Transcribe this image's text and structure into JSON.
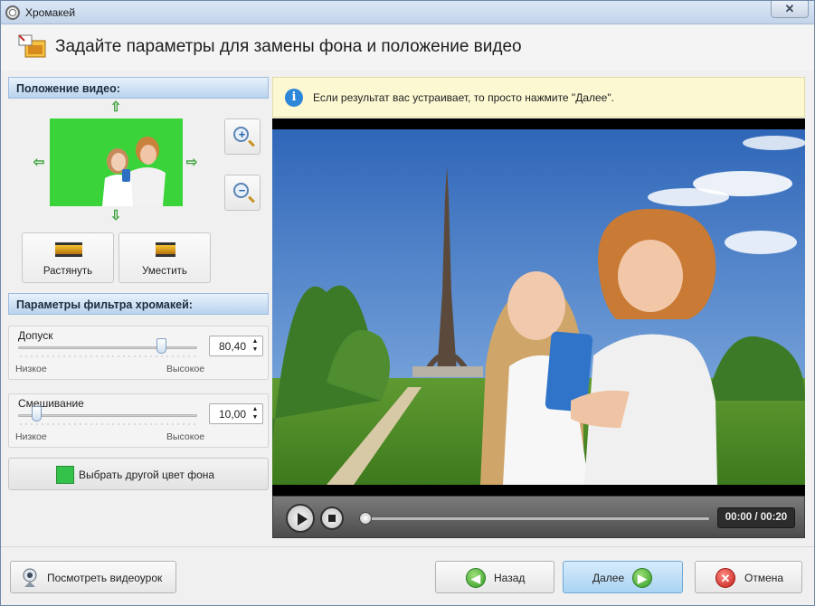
{
  "window": {
    "title": "Хромакей",
    "close_label": "✕"
  },
  "header": {
    "title": "Задайте параметры для замены фона и положение видео"
  },
  "position": {
    "heading": "Положение видео:",
    "stretch_label": "Растянуть",
    "fit_label": "Уместить"
  },
  "filter": {
    "heading": "Параметры фильтра хромакей:",
    "tolerance": {
      "label": "Допуск",
      "value": "80,40",
      "low": "Низкое",
      "high": "Высокое",
      "level": 0.8
    },
    "blending": {
      "label": "Смешивание",
      "value": "10,00",
      "low": "Низкое",
      "high": "Высокое",
      "level": 0.1
    },
    "color_button": "Выбрать другой цвет фона",
    "key_color": "#34c24a"
  },
  "info": {
    "text": "Если результат вас устраивает, то просто нажмите \"Далее\"."
  },
  "player": {
    "time": "00:00 / 00:20",
    "progress": 0
  },
  "footer": {
    "tutorial": "Посмотреть видеоурок",
    "back": "Назад",
    "next": "Далее",
    "cancel": "Отмена"
  },
  "icons": {
    "up": "arrow-up-icon",
    "down": "arrow-down-icon",
    "left": "arrow-left-icon",
    "right": "arrow-right-icon",
    "zoom_in": "zoom-in-icon",
    "zoom_out": "zoom-out-icon",
    "info": "info-icon",
    "webcam": "webcam-icon",
    "back": "arrow-left-circle-icon",
    "next": "arrow-right-circle-icon",
    "cancel": "cancel-circle-icon"
  }
}
